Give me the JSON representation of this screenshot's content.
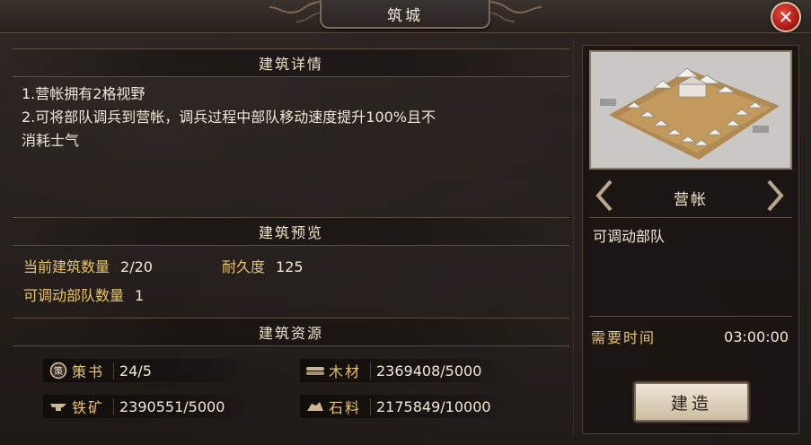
{
  "window": {
    "title": "筑城",
    "close_icon": "close-icon"
  },
  "details": {
    "header": "建筑详情",
    "lines": [
      "1.营帐拥有2格视野",
      "2.可将部队调兵到营帐，调兵过程中部队移动速度提升100%且不\n消耗士气"
    ]
  },
  "preview": {
    "header": "建筑预览",
    "count_label": "当前建筑数量",
    "count_value": "2/20",
    "durability_label": "耐久度",
    "durability_value": "125",
    "troops_label": "可调动部队数量",
    "troops_value": "1"
  },
  "resources": {
    "header": "建筑资源",
    "items": [
      {
        "icon": "strategy-book-icon",
        "label": "策书",
        "value": "24/5"
      },
      {
        "icon": "wood-icon",
        "label": "木材",
        "value": "2369408/5000"
      },
      {
        "icon": "iron-ore-icon",
        "label": "铁矿",
        "value": "2390551/5000"
      },
      {
        "icon": "stone-icon",
        "label": "石料",
        "value": "2175849/10000"
      }
    ]
  },
  "building": {
    "name": "营帐",
    "description": "可调动部队",
    "time_label": "需要时间",
    "time_value": "03:00:00",
    "build_button": "建造"
  },
  "colors": {
    "gold_label": "#e7c36e",
    "text": "#f0e7d6",
    "close_red": "#c0221b"
  }
}
